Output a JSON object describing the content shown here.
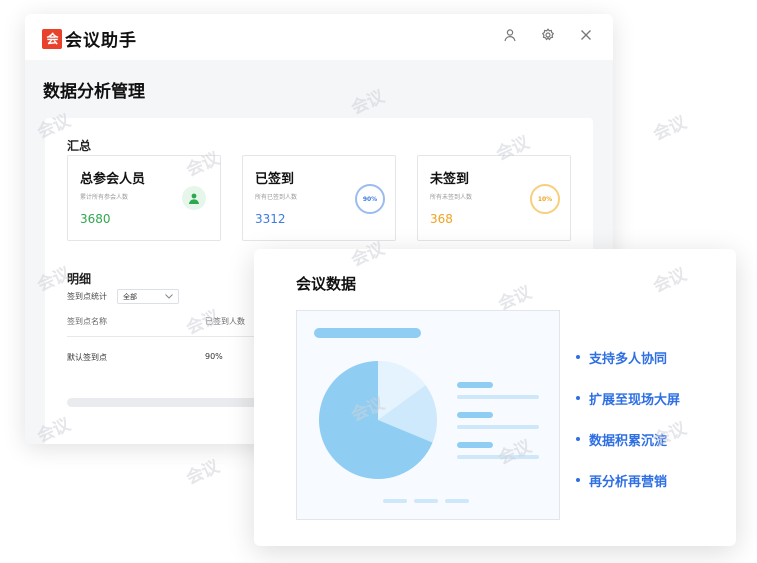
{
  "app": {
    "logo_mark": "会",
    "logo_text": "会议助手"
  },
  "page_title": "数据分析管理",
  "summary": {
    "section_title": "汇总",
    "cards": [
      {
        "title": "总参会人员",
        "subtitle": "累计所有参会人数",
        "value": "3680",
        "color": "#2ea84f"
      },
      {
        "title": "已签到",
        "subtitle": "所有已签到人数",
        "value": "3312",
        "color": "#3b7be3",
        "ring_label": "90%",
        "ring_color": "#9bbcf0"
      },
      {
        "title": "未签到",
        "subtitle": "所有未签到人数",
        "value": "368",
        "color": "#f0a321",
        "ring_label": "10%",
        "ring_color": "#f7cf7e"
      }
    ]
  },
  "detail": {
    "section_title": "明细",
    "filter_label": "签到点统计",
    "filter_value": "全部",
    "columns": [
      "签到点名称",
      "已签到人数"
    ],
    "rows": [
      {
        "name": "默认签到点",
        "rate": "90%"
      }
    ]
  },
  "front_card": {
    "title": "会议数据",
    "features": [
      "支持多人协同",
      "扩展至现场大屏",
      "数据积累沉淀",
      "再分析再营销"
    ]
  },
  "watermark_text": "会议"
}
